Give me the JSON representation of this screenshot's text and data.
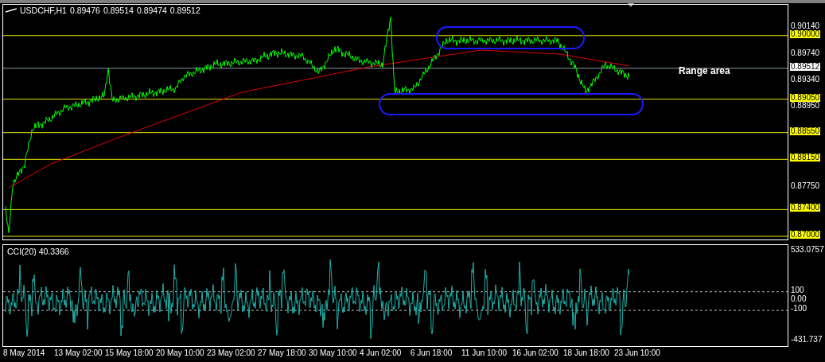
{
  "chart": {
    "symbol": "USDCHF,H1",
    "quotes": [
      "0.89476",
      "0.89514",
      "0.89474",
      "0.89512"
    ],
    "annotation": "Range area",
    "price_axis": [
      {
        "text": "0.90140",
        "kind": "tick"
      },
      {
        "text": "0.90000",
        "kind": "level"
      },
      {
        "text": "0.89740",
        "kind": "tick"
      },
      {
        "text": "0.89512",
        "kind": "current"
      },
      {
        "text": "0.89340",
        "kind": "tick"
      },
      {
        "text": "0.89050",
        "kind": "level"
      },
      {
        "text": "0.88950",
        "kind": "tick"
      },
      {
        "text": "0.88550",
        "kind": "level"
      },
      {
        "text": "0.88150",
        "kind": "level"
      },
      {
        "text": "0.87750",
        "kind": "tick"
      },
      {
        "text": "0.87400",
        "kind": "level"
      },
      {
        "text": "0.87000",
        "kind": "level"
      }
    ]
  },
  "indicator": {
    "label": "CCI(20) 40.3366",
    "axis": [
      {
        "text": "533.0757",
        "kind": "tick"
      },
      {
        "text": "100",
        "kind": "level"
      },
      {
        "text": "0.00",
        "kind": "tick"
      },
      {
        "text": "-100",
        "kind": "level"
      },
      {
        "text": "-431.737",
        "kind": "tick"
      }
    ]
  },
  "time_axis": [
    "8 May 2014",
    "13 May 02:00",
    "15 May 18:00",
    "20 May 10:00",
    "23 May 02:00",
    "27 May 18:00",
    "30 May 10:00",
    "4 Jun 02:00",
    "6 Jun 18:00",
    "11 Jun 10:00",
    "16 Jun 02:00",
    "18 Jun 18:00",
    "23 Jun 10:00"
  ]
}
